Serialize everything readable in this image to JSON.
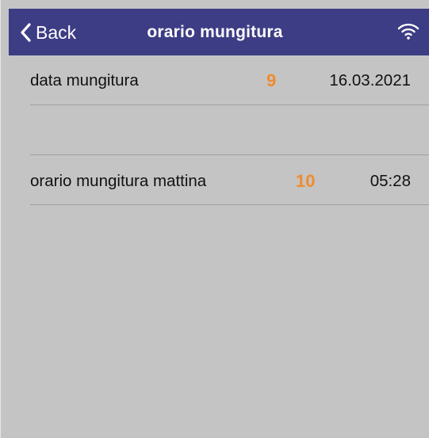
{
  "navbar": {
    "back_label": "Back",
    "title": "orario mungitura",
    "back_icon": "chevron-left-icon",
    "status_icon": "wifi-icon",
    "background": "#3d3d86"
  },
  "rows": [
    {
      "label": "data mungitura",
      "badge": "9",
      "value": "16.03.2021"
    },
    {
      "label": "",
      "badge": "",
      "value": ""
    },
    {
      "label": "orario mungitura mattina",
      "badge": "10",
      "value": "05:28"
    }
  ],
  "colors": {
    "background": "#c4c4c4",
    "badge": "#f08b2e",
    "divider": "#9e9e9e"
  }
}
